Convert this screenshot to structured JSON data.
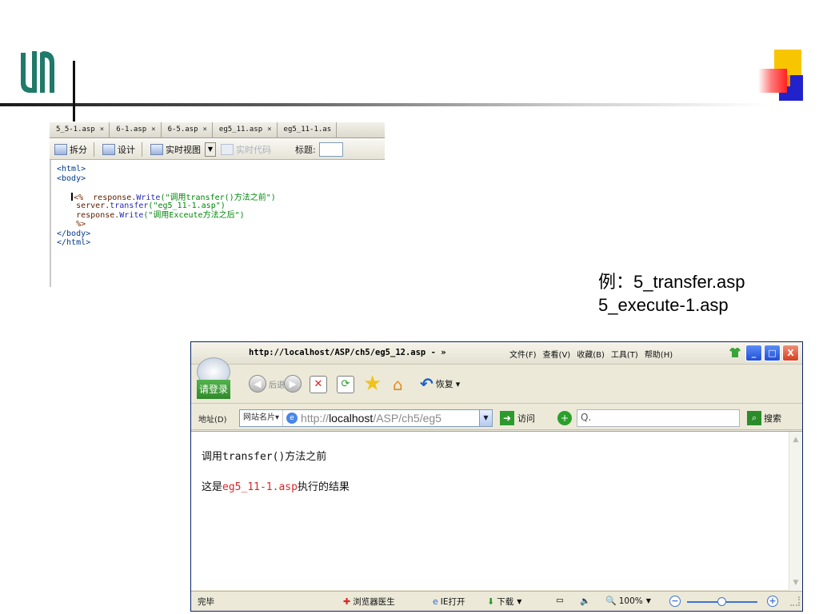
{
  "editor": {
    "tabs": [
      "5_5-1.asp",
      "6-1.asp",
      "6-5.asp",
      "eg5_11.asp",
      "eg5_11-1.as"
    ],
    "tab_close": "×",
    "toolbar": {
      "split": "拆分",
      "design": "设计",
      "live_view": "实时视图",
      "live_code": "实时代码",
      "title_label": "标题:"
    },
    "code": {
      "l1": "<html>",
      "l2": "<body>",
      "l4_open": "<%",
      "l4_obj": "response.",
      "l4_fn": "Write",
      "l4_str": "(\"调用transfer()方法之前\")",
      "l5_obj": "server.",
      "l5_fn": "transfer",
      "l5_str": "(\"eg5_11-1.asp\")",
      "l6_obj": "response.",
      "l6_fn": "Write",
      "l6_str": "(\"调用Exceute方法之后\")",
      "l7": "%>",
      "l8": "</body>",
      "l9": "</html>"
    }
  },
  "caption": {
    "line1": "例：5_transfer.asp",
    "line2": "5_execute-1.asp"
  },
  "browser": {
    "title": "http://localhost/ASP/ch5/eg5_12.asp - »",
    "menu": [
      "文件(F)",
      "查看(V)",
      "收藏(B)",
      "工具(T)",
      "帮助(H)"
    ],
    "window_buttons": {
      "minimize": "_",
      "maximize": "□",
      "close": "X"
    },
    "login_label": "请登录",
    "nav": {
      "back": "后退",
      "restore": "恢复",
      "restore_dropdown": "▾"
    },
    "address": {
      "label": "地址(D)",
      "site_card": "网站名片▾",
      "url_prefix": "http://",
      "url_host": "localhost",
      "url_path": "/ASP/ch5/eg5",
      "go": "访问",
      "search_placeholder": "Q.",
      "search": "搜索"
    },
    "content": {
      "line1": "调用transfer()方法之前",
      "line2_pre": "这是",
      "line2_red": "eg5_11-1.asp",
      "line2_post": "执行的结果"
    },
    "status": {
      "done": "完毕",
      "doctor": "浏览器医生",
      "ie_open": "IE打开",
      "download": "下载",
      "zoom": "100%"
    }
  },
  "colors": {
    "title_red": "#d8282b",
    "accent_yellow": "#f7c600",
    "accent_blue": "#2222cc"
  }
}
